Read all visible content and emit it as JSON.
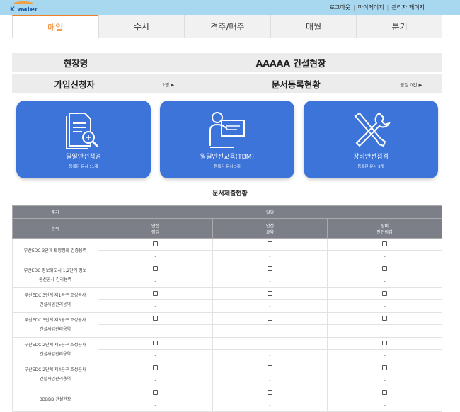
{
  "header": {
    "logo_text": "K water",
    "links": [
      "로그아웃",
      "마이페이지",
      "관리자 페이지"
    ]
  },
  "tabs": [
    {
      "label": "매일",
      "active": true
    },
    {
      "label": "수시",
      "active": false
    },
    {
      "label": "격주/매주",
      "active": false
    },
    {
      "label": "매월",
      "active": false
    },
    {
      "label": "분기",
      "active": false
    }
  ],
  "info": {
    "site_label": "현장명",
    "site_value": "AAAAA 건설현장",
    "applicant_label": "가입신청자",
    "applicant_count": "2명 ▶",
    "doc_status_label": "문서등록현황",
    "doc_status_value": "금일 0건 ▶"
  },
  "cards": [
    {
      "title": "일일안전점검",
      "sub": "등록된 문서 11개",
      "icon": "document-search-icon"
    },
    {
      "title": "일일안전교육(TBM)",
      "sub": "등록된 문서 3개",
      "icon": "presentation-icon"
    },
    {
      "title": "장비안전점검",
      "sub": "등록된 문서 3개",
      "icon": "wrench-screwdriver-icon"
    }
  ],
  "table": {
    "title": "문서제출현황",
    "period_label": "주기",
    "period_value": "일일",
    "item_label": "항목",
    "columns": [
      "안전\n점검",
      "안전\n교육",
      "장비\n안전점검"
    ],
    "rows": [
      {
        "name": "부산EDC 3단계 토양정화 검증용역"
      },
      {
        "name": "부산EDC 정보화도시 1,2단계 정보통신공사 감리용역"
      },
      {
        "name": "부산EDC 3단계 제1공구 조성공사 건설사업관리용역"
      },
      {
        "name": "부산EDC 3단계 제3공구 조성공사 건설사업관리용역"
      },
      {
        "name": "부산EDC 2단계 제5공구 조성공사 건설사업관리용역"
      },
      {
        "name": "부산EDC 2단계 제4공구 조성공사 건설사업관리용역"
      },
      {
        "name": "BBBBB 건설현장"
      }
    ],
    "dash": "-"
  }
}
